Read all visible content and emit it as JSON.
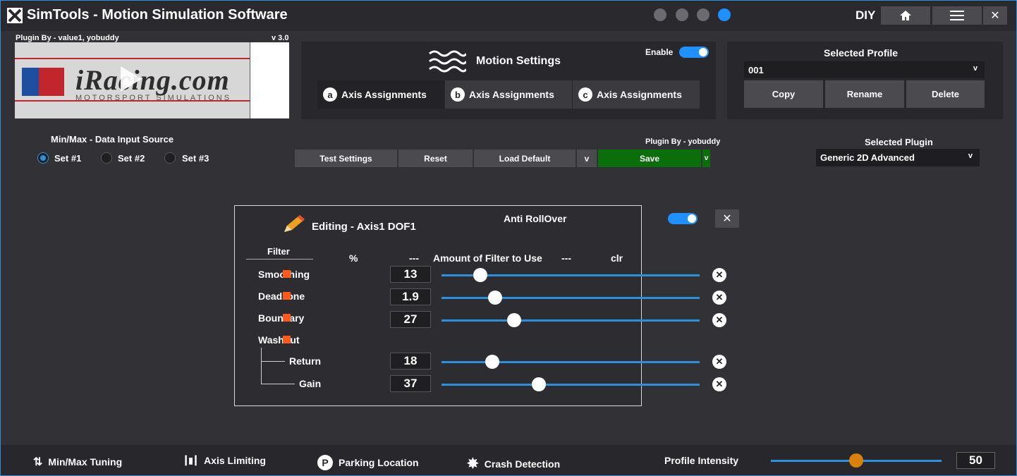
{
  "app": {
    "title": "SimTools - Motion Simulation Software",
    "mode": "DIY"
  },
  "titlebar": {
    "icons": [
      "download-icon",
      "crash-icon",
      "pencil-icon",
      "power-icon"
    ],
    "home_icon": "home-icon",
    "menu_icon": "menu-icon",
    "close_icon": "✕"
  },
  "plugin_preview": {
    "plugin_by": "Plugin By - value1, yobuddy",
    "version": "v 3.0",
    "brand": "iRacing.com",
    "brand_sub": "MOTORSPORT SIMULATIONS"
  },
  "motion_settings": {
    "title": "Motion Settings",
    "enable_label": "Enable",
    "enabled": true,
    "tabs": [
      {
        "letter": "a",
        "label": "Axis Assignments"
      },
      {
        "letter": "b",
        "label": "Axis Assignments"
      },
      {
        "letter": "c",
        "label": "Axis Assignments"
      }
    ]
  },
  "profile": {
    "title": "Selected Profile",
    "value": "001",
    "chevron": "v",
    "buttons": [
      "Copy",
      "Rename",
      "Delete"
    ]
  },
  "data_input": {
    "title": "Min/Max - Data Input Source",
    "options": [
      "Set #1",
      "Set #2",
      "Set #3"
    ],
    "selected": "Set #1"
  },
  "toolbar": {
    "plugin_by": "Plugin By - yobuddy",
    "test_label": "Test Settings",
    "reset_label": "Reset",
    "load_default_label": "Load Default",
    "dropdown_glyph": "v",
    "save_label": "Save",
    "save_glyph": "v"
  },
  "selected_plugin": {
    "title": "Selected Plugin",
    "value": "Generic 2D Advanced",
    "chevron": "v"
  },
  "editing": {
    "title": "Editing - Axis1 DOF1",
    "anti_rollover_label": "Anti RollOver",
    "anti_rollover_on": true,
    "close_glyph": "✕",
    "headers": {
      "filter": "Filter",
      "percent": "%",
      "dash_left": "---",
      "amount": "Amount of Filter to Use",
      "dash_right": "---",
      "clr": "clr"
    },
    "clr_glyph": "✕",
    "filters": [
      {
        "label": "Smoothing",
        "value": "13",
        "percent": 13
      },
      {
        "label": "Deadzone",
        "value": "1.9",
        "percent": 19
      },
      {
        "label": "Boundary",
        "value": "27",
        "percent": 27
      },
      {
        "label": "Washout"
      },
      {
        "label": "Return",
        "value": "18",
        "percent": 18
      },
      {
        "label": "Gain",
        "value": "37",
        "percent": 37
      }
    ]
  },
  "bottom": {
    "items": [
      {
        "label": "Min/Max Tuning",
        "icon": "⇅"
      },
      {
        "label": "Axis Limiting",
        "icon": "┃▮┃"
      },
      {
        "label": "Parking Location",
        "icon": "P"
      },
      {
        "label": "Crash Detection",
        "icon": "✸"
      }
    ],
    "intensity_label": "Profile Intensity",
    "intensity_value": "50",
    "intensity_percent": 50
  }
}
